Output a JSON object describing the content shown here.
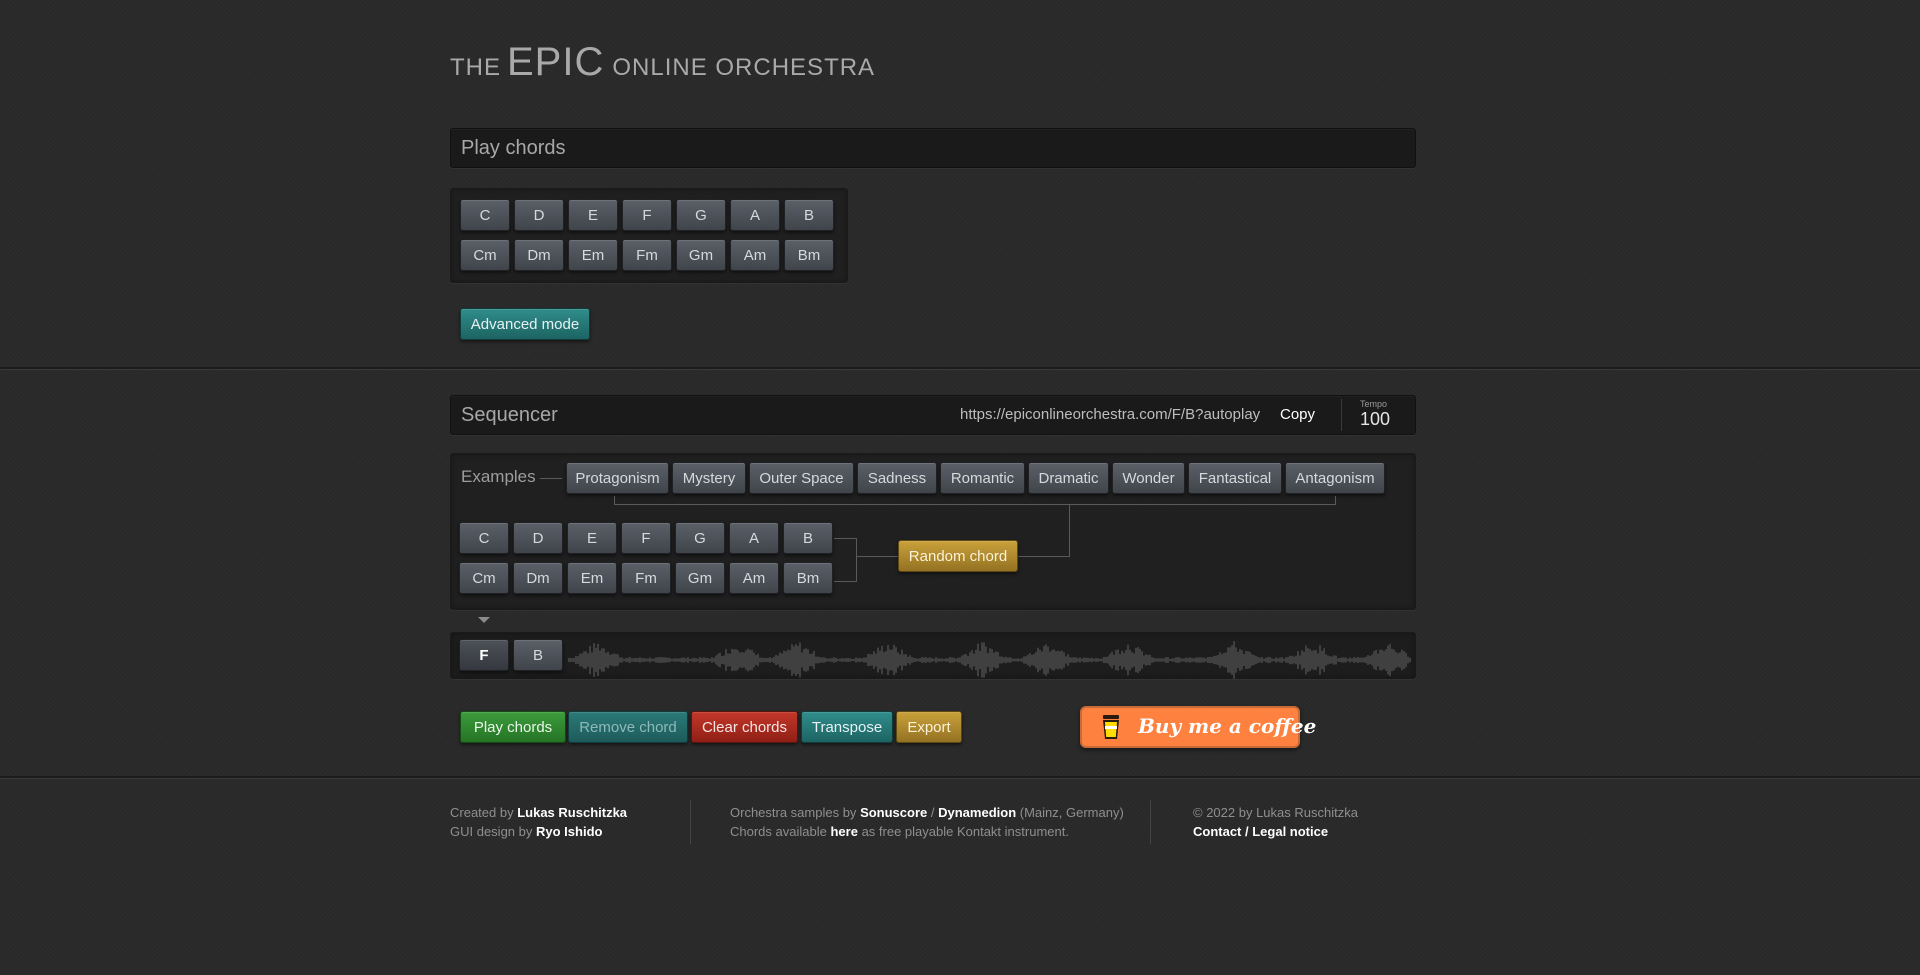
{
  "logo": {
    "the": "THE",
    "epic": "EPIC",
    "rest": "ONLINE ORCHESTRA"
  },
  "play_chords_panel": {
    "title": "Play chords",
    "major": [
      "C",
      "D",
      "E",
      "F",
      "G",
      "A",
      "B"
    ],
    "minor": [
      "Cm",
      "Dm",
      "Em",
      "Fm",
      "Gm",
      "Am",
      "Bm"
    ],
    "advanced_mode_label": "Advanced mode"
  },
  "sequencer": {
    "title": "Sequencer",
    "url": "https://epiconlineorchestra.com/F/B?autoplay",
    "copy_label": "Copy",
    "tempo_label": "Tempo",
    "tempo_value": "100",
    "examples_label": "Examples",
    "examples": [
      "Protagonism",
      "Mystery",
      "Outer Space",
      "Sadness",
      "Romantic",
      "Dramatic",
      "Wonder",
      "Fantastical",
      "Antagonism"
    ],
    "major": [
      "C",
      "D",
      "E",
      "F",
      "G",
      "A",
      "B"
    ],
    "minor": [
      "Cm",
      "Dm",
      "Em",
      "Fm",
      "Gm",
      "Am",
      "Bm"
    ],
    "random_chord_label": "Random chord",
    "timeline": [
      "F",
      "B"
    ]
  },
  "actions": {
    "play": "Play chords",
    "remove": "Remove chord",
    "clear": "Clear chords",
    "transpose": "Transpose",
    "export": "Export"
  },
  "coffee": {
    "label": "Buy me a coffee"
  },
  "footer": {
    "created_by": "Created by",
    "creator": "Lukas Ruschitzka",
    "gui_by": "GUI design by",
    "gui_designer": "Ryo Ishido",
    "samples_by": "Orchestra samples by",
    "sonuscore": "Sonuscore",
    "slash": "/",
    "dynamedion": "Dynamedion",
    "location": "(Mainz, Germany)",
    "chords_available": "Chords available",
    "here": "here",
    "kontakt": "as free playable Kontakt instrument.",
    "copyright": "© 2022 by Lukas Ruschitzka",
    "legal": "Contact / Legal notice"
  },
  "colors": {
    "background": "#2a2a2a",
    "teal": "#2f8d8b",
    "green": "#3c9c3c",
    "red": "#c4372a",
    "gold": "#c9a13b",
    "coffee": "#ff813f"
  }
}
